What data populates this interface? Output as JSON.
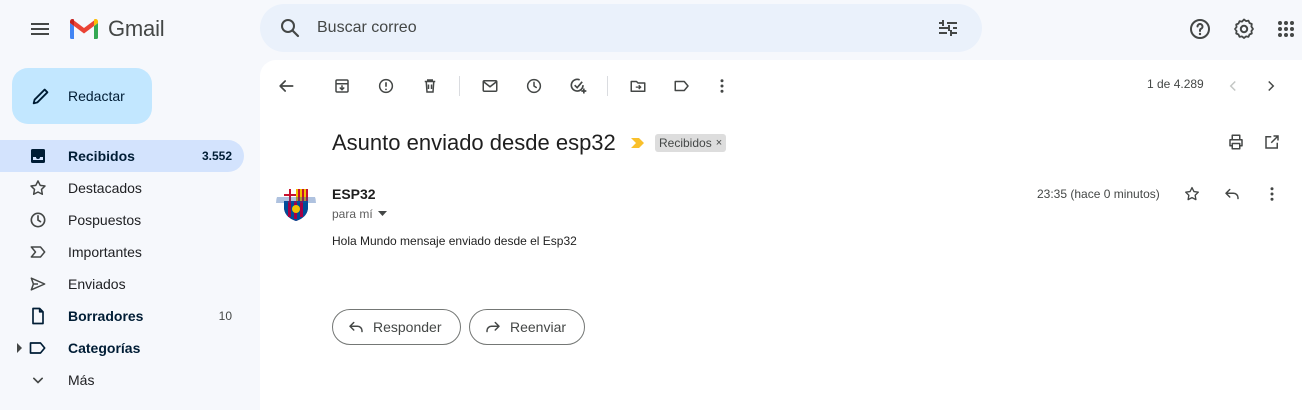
{
  "app": {
    "name": "Gmail"
  },
  "search": {
    "placeholder": "Buscar correo"
  },
  "compose": {
    "label": "Redactar"
  },
  "sidebar": {
    "items": [
      {
        "label": "Recibidos",
        "count": "3.552",
        "icon": "inbox-icon"
      },
      {
        "label": "Destacados",
        "count": "",
        "icon": "star-icon"
      },
      {
        "label": "Pospuestos",
        "count": "",
        "icon": "clock-icon"
      },
      {
        "label": "Importantes",
        "count": "",
        "icon": "important-icon"
      },
      {
        "label": "Enviados",
        "count": "",
        "icon": "send-icon"
      },
      {
        "label": "Borradores",
        "count": "10",
        "icon": "draft-icon"
      },
      {
        "label": "Categorías",
        "count": "",
        "icon": "label-icon"
      },
      {
        "label": "Más",
        "count": "",
        "icon": "chevron-down-icon"
      }
    ]
  },
  "toolbar": {
    "pager": "1 de 4.289"
  },
  "message": {
    "subject": "Asunto enviado desde esp32",
    "label_chip": "Recibidos",
    "label_chip_close": "×",
    "sender": "ESP32",
    "recipient": "para mí",
    "time": "23:35 (hace 0 minutos)",
    "body": "Hola Mundo mensaje enviado desde el Esp32"
  },
  "actions": {
    "reply": "Responder",
    "forward": "Reenviar"
  },
  "colors": {
    "background": "#f6f8fc",
    "search_bg": "#eaf1fb",
    "compose_bg": "#c2e7ff",
    "active_nav": "#d3e3fd",
    "importance_marker": "#f9c02b"
  }
}
